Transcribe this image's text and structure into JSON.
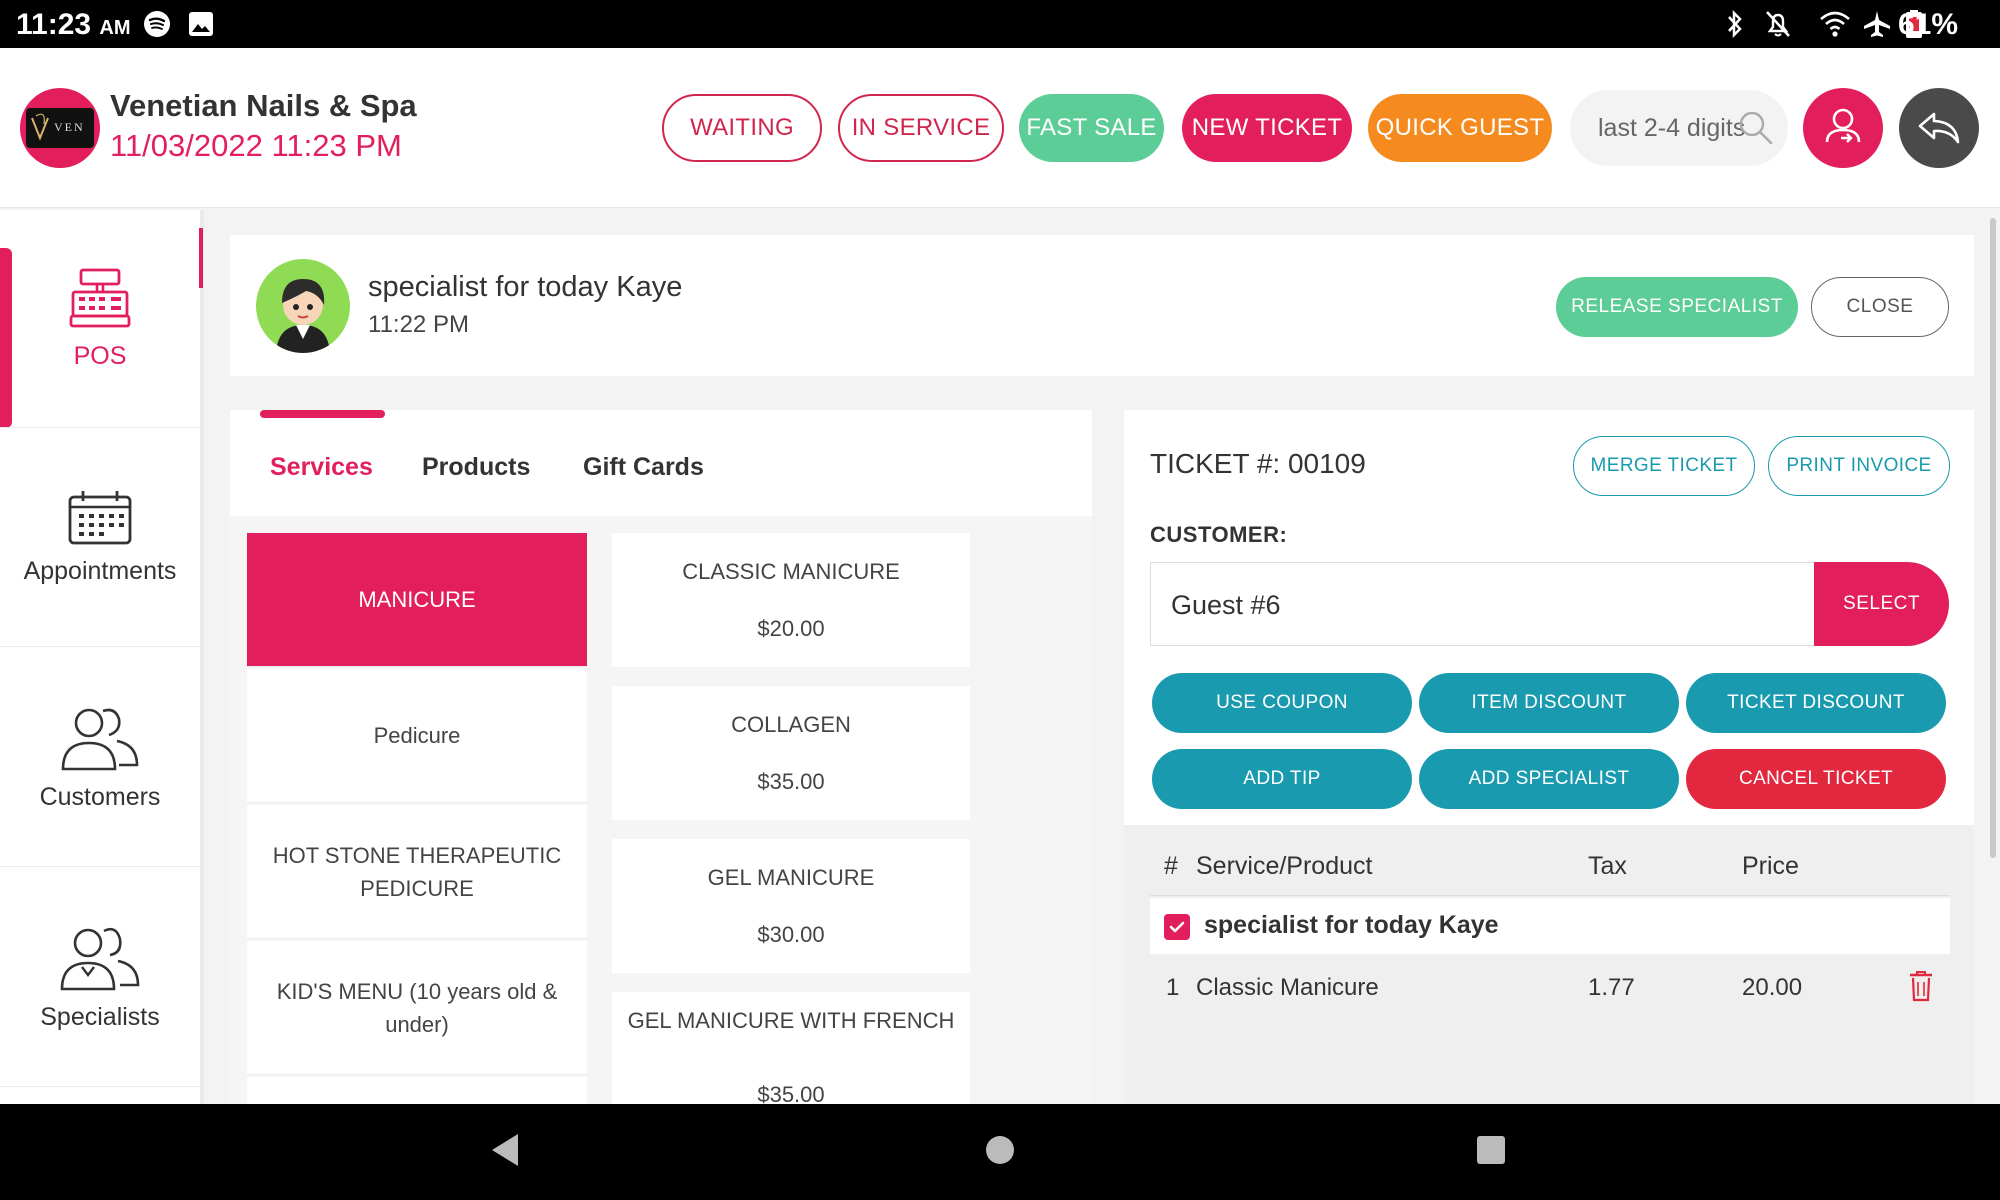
{
  "status_bar": {
    "time": "11:23",
    "ampm": "AM",
    "battery": "61%"
  },
  "header": {
    "store_name": "Venetian Nails & Spa",
    "datetime": "11/03/2022 11:23 PM",
    "logo_text": "VEN",
    "buttons": {
      "waiting": "WAITING",
      "in_service": "IN SERVICE",
      "fast_sale": "FAST SALE",
      "new_ticket": "NEW TICKET",
      "quick_guest": "QUICK GUEST"
    },
    "search_placeholder": "last 2-4 digits",
    "icons": {
      "search": "search-icon",
      "specialist": "user-swap-icon",
      "back": "reply-arrow-icon"
    }
  },
  "sidebar": {
    "items": [
      {
        "label": "POS",
        "icon": "cash-register-icon"
      },
      {
        "label": "Appointments",
        "icon": "calendar-icon"
      },
      {
        "label": "Customers",
        "icon": "customers-icon"
      },
      {
        "label": "Specialists",
        "icon": "specialists-icon"
      }
    ]
  },
  "specialist": {
    "name": "specialist for today Kaye",
    "time": "11:22 PM",
    "release_label": "RELEASE SPECIALIST",
    "close_label": "CLOSE"
  },
  "services": {
    "tabs": [
      "Services",
      "Products",
      "Gift Cards"
    ],
    "categories": [
      "MANICURE",
      "Pedicure",
      "HOT STONE THERAPEUTIC PEDICURE",
      "KID'S MENU (10 years old & under)"
    ],
    "items": [
      {
        "name": "CLASSIC MANICURE",
        "price": "$20.00"
      },
      {
        "name": "COLLAGEN",
        "price": "$35.00"
      },
      {
        "name": "GEL MANICURE",
        "price": "$30.00"
      },
      {
        "name": "GEL MANICURE WITH FRENCH",
        "price": "$35.00"
      }
    ]
  },
  "ticket": {
    "number_label": "TICKET #: 00109",
    "merge_label": "MERGE TICKET",
    "print_label": "PRINT INVOICE",
    "customer_label": "CUSTOMER:",
    "customer_value": "Guest #6",
    "select_label": "SELECT",
    "actions": {
      "use_coupon": "USE COUPON",
      "item_discount": "ITEM DISCOUNT",
      "ticket_discount": "TICKET DISCOUNT",
      "add_tip": "ADD TIP",
      "add_specialist": "ADD SPECIALIST",
      "cancel_ticket": "CANCEL TICKET"
    },
    "table": {
      "headers": {
        "num": "#",
        "item": "Service/Product",
        "tax": "Tax",
        "price": "Price"
      },
      "group": "specialist for today Kaye",
      "rows": [
        {
          "num": "1",
          "item": "Classic Manicure",
          "tax": "1.77",
          "price": "20.00"
        }
      ]
    }
  },
  "colors": {
    "brand_pink": "#e21f5c",
    "green": "#5ccd96",
    "orange": "#f58b1f",
    "teal": "#1a9aaf",
    "red": "#e2283f"
  }
}
